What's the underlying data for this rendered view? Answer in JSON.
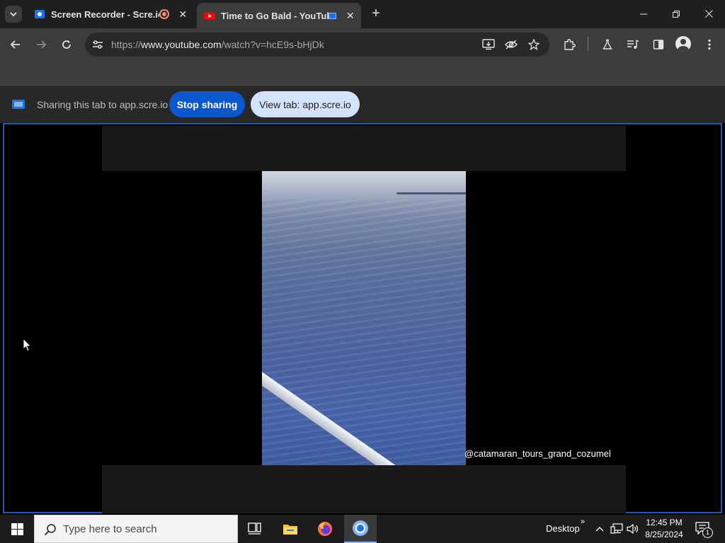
{
  "browser": {
    "tabs": [
      {
        "title": "Screen Recorder - Scre.io",
        "active": false
      },
      {
        "title": "Time to Go Bald - YouTube",
        "active": true
      }
    ],
    "url": {
      "scheme": "https://",
      "host": "www.youtube.com",
      "path": "/watch?v=hcE9s-bHjDk"
    }
  },
  "infobar": {
    "message": "Sharing this tab to app.scre.io",
    "stop_label": "Stop sharing",
    "view_label": "View tab: app.scre.io"
  },
  "video": {
    "watermark": "@catamaran_tours_grand_cozumel"
  },
  "taskbar": {
    "search_placeholder": "Type here to search",
    "desktop_label": "Desktop",
    "time": "12:45 PM",
    "date": "8/25/2024",
    "notification_count": "1"
  },
  "colors": {
    "accent": "#0b57d0",
    "share_border": "#1a5fb4",
    "youtube_red": "#ff0000"
  }
}
